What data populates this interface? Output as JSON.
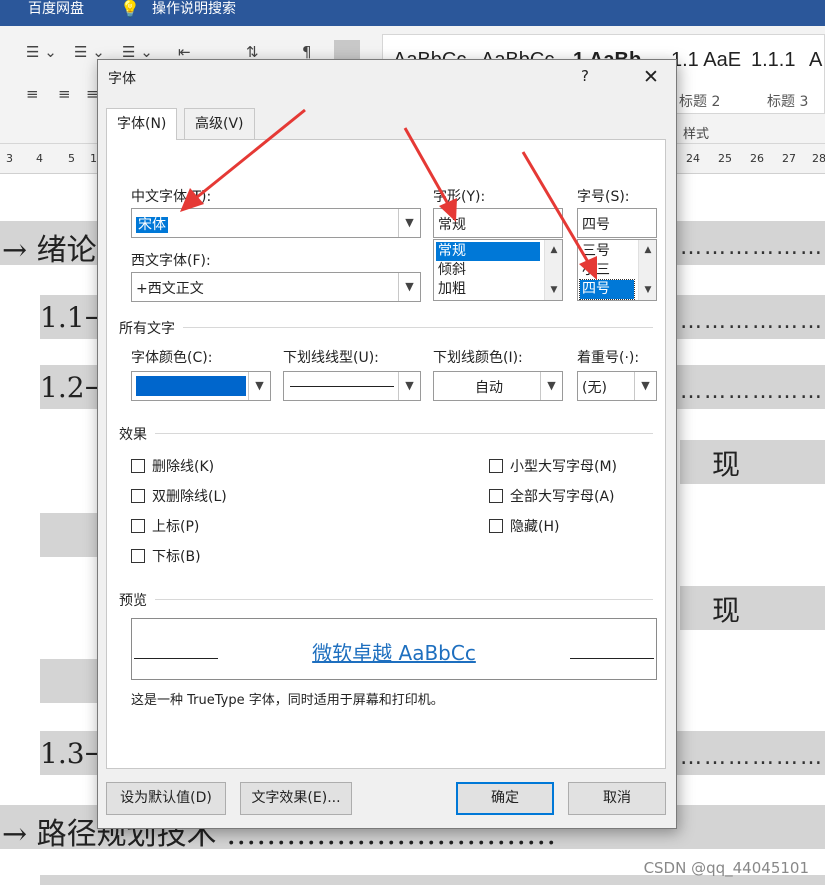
{
  "titlebar": {
    "items": [
      "百度网盘",
      "操作说明搜索"
    ],
    "lightbulb_icon": "lightbulb-icon"
  },
  "ribbon": {
    "styles": [
      {
        "sample": "AaBbCc",
        "name": ""
      },
      {
        "sample": "AaBbCc",
        "name": ""
      },
      {
        "sample": "1 AaBb",
        "name": ""
      },
      {
        "sample": "1.1  AaE",
        "name": "标题 2"
      },
      {
        "sample": "1.1.1",
        "name": "标题 3"
      },
      {
        "sample": "A",
        "name": ""
      }
    ],
    "group_label_styles": "样式"
  },
  "ruler": {
    "left_ticks": [
      "3",
      "4",
      "5",
      "1"
    ],
    "right_ticks": [
      "24",
      "25",
      "26",
      "27",
      "28"
    ]
  },
  "document": {
    "headings": [
      {
        "text": "→ 绪论"
      },
      {
        "text": "1.1→"
      },
      {
        "text": "1.2→"
      },
      {
        "text": "现"
      },
      {
        "text": "现"
      },
      {
        "text": "1.3→"
      },
      {
        "text": "→ 路径规划技术 ……………………………"
      }
    ],
    "dots": "…………………………………"
  },
  "watermark": "CSDN @qq_44045101",
  "dialog": {
    "title": "字体",
    "help": "?",
    "close": "✕",
    "tabs": [
      "字体(N)",
      "高级(V)"
    ],
    "labels": {
      "chinese_font": "中文字体(T):",
      "font_style": "字形(Y):",
      "font_size": "字号(S):",
      "western_font": "西文字体(F):",
      "all_text": "所有文字",
      "font_color": "字体颜色(C):",
      "underline_style": "下划线线型(U):",
      "underline_color": "下划线颜色(I):",
      "emphasis_mark": "着重号(·):",
      "effects": "效果",
      "preview": "预览"
    },
    "chinese_font_value": "宋体",
    "western_font_value": "+西文正文",
    "font_style_value": "常规",
    "font_style_list": [
      "常规",
      "倾斜",
      "加粗"
    ],
    "font_size_value": "四号",
    "font_size_list": [
      "三号",
      "小三",
      "四号"
    ],
    "underline_color_value": "自动",
    "emphasis_value": "(无)",
    "effects": {
      "strikethrough": "删除线(K)",
      "double_strikethrough": "双删除线(L)",
      "superscript": "上标(P)",
      "subscript": "下标(B)",
      "small_caps": "小型大写字母(M)",
      "all_caps": "全部大写字母(A)",
      "hidden": "隐藏(H)"
    },
    "preview_sample": "微软卓越  AaBbCc",
    "truetype_note": "这是一种 TrueType 字体，同时适用于屏幕和打印机。",
    "buttons": {
      "set_default": "设为默认值(D)",
      "text_effects": "文字效果(E)...",
      "ok": "确定",
      "cancel": "取消"
    },
    "colors": {
      "font_color": "#0066cc",
      "selection": "#0078d7",
      "annotation_arrow": "#e53935"
    }
  }
}
